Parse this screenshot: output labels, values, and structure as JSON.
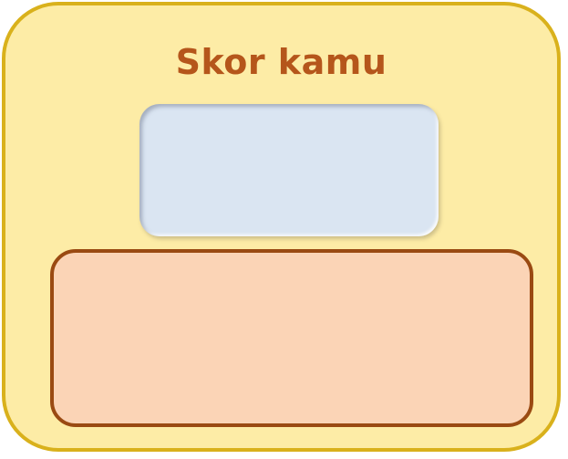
{
  "score_card": {
    "title": "Skor kamu",
    "score_value": "",
    "message": ""
  },
  "colors": {
    "card_background": "#fdeca6",
    "card_border": "#d9b11c",
    "title_text": "#b5561b",
    "score_display_background": "#dae5f2",
    "message_panel_background": "#fbd4b6",
    "message_panel_border": "#9a4a12"
  }
}
